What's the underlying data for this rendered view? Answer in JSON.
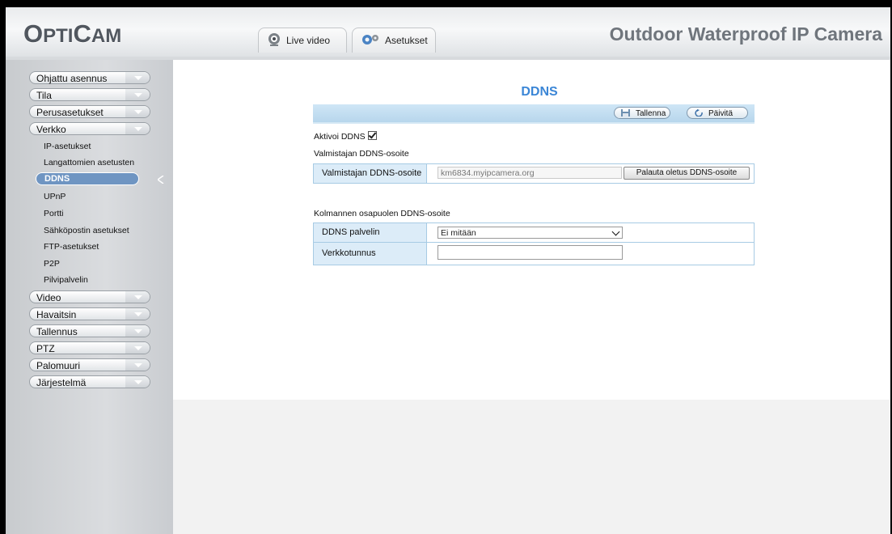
{
  "header": {
    "logo": "OptiCam",
    "logo_parts": [
      "O",
      "PTI",
      "C",
      "AM"
    ],
    "tabs": [
      {
        "label": "Live video",
        "icon": "webcam-icon"
      },
      {
        "label": "Asetukset",
        "icon": "gears-icon"
      }
    ],
    "title": "Outdoor Waterproof IP Camera"
  },
  "sidebar": {
    "groups": [
      {
        "label": "Ohjattu asennus"
      },
      {
        "label": "Tila"
      },
      {
        "label": "Perusasetukset"
      },
      {
        "label": "Verkko"
      }
    ],
    "verkko_items": [
      {
        "label": "IP-asetukset"
      },
      {
        "label": "Langattomien asetusten"
      },
      {
        "label": "DDNS",
        "selected": true
      },
      {
        "label": "UPnP"
      },
      {
        "label": "Portti"
      },
      {
        "label": "Sähköpostin asetukset"
      },
      {
        "label": "FTP-asetukset"
      },
      {
        "label": "P2P"
      },
      {
        "label": "Pilvipalvelin"
      }
    ],
    "groups_after": [
      {
        "label": "Video"
      },
      {
        "label": "Havaitsin"
      },
      {
        "label": "Tallennus"
      },
      {
        "label": "PTZ"
      },
      {
        "label": "Palomuuri"
      },
      {
        "label": "Järjestelmä"
      }
    ]
  },
  "page": {
    "title": "DDNS",
    "toolbar": {
      "save_label": "Tallenna",
      "refresh_label": "Päivitä"
    },
    "enable_ddns_label": "Aktivoi DDNS",
    "enable_ddns_checked": true,
    "oem_section_label": "Valmistajan DDNS-osoite",
    "oem_row": {
      "key": "Valmistajan DDNS-osoite",
      "value": "km6834.myipcamera.org",
      "restore_label": "Palauta oletus DDNS-osoite"
    },
    "third_party_section_label": "Kolmannen osapuolen DDNS-osoite",
    "third_party_rows": {
      "server_key": "DDNS palvelin",
      "server_value": "Ei mitään",
      "account_key": "Verkkotunnus",
      "account_value": ""
    }
  },
  "colors": {
    "accent": "#3b86d6",
    "selected_item": "#6f95c2",
    "toolbar": "#c3dff2",
    "table_key_bg": "#dcecf8"
  }
}
